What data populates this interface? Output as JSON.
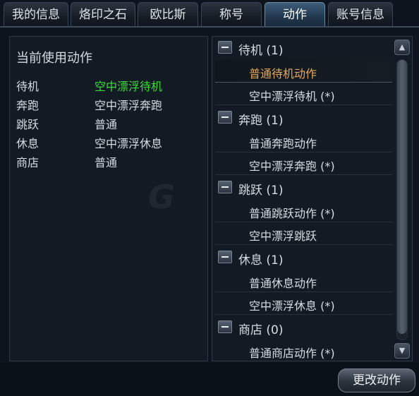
{
  "tabs": [
    {
      "label": "我的信息"
    },
    {
      "label": "烙印之石"
    },
    {
      "label": "欧比斯"
    },
    {
      "label": "称号"
    },
    {
      "label": "动作",
      "active": true
    },
    {
      "label": "账号信息"
    }
  ],
  "current": {
    "title": "当前使用动作",
    "rows": [
      {
        "key": "待机",
        "value": "空中漂浮待机",
        "highlight": true
      },
      {
        "key": "奔跑",
        "value": "空中漂浮奔跑"
      },
      {
        "key": "跳跃",
        "value": "普通"
      },
      {
        "key": "休息",
        "value": "空中漂浮休息"
      },
      {
        "key": "商店",
        "value": "普通"
      }
    ]
  },
  "action_list": [
    {
      "category": "待机 (1)",
      "items": [
        {
          "label": "普通待机动作",
          "selected": true
        },
        {
          "label": "空中漂浮待机 (*)"
        }
      ]
    },
    {
      "category": "奔跑 (1)",
      "items": [
        {
          "label": "普通奔跑动作"
        },
        {
          "label": "空中漂浮奔跑 (*)"
        }
      ]
    },
    {
      "category": "跳跃 (1)",
      "items": [
        {
          "label": "普通跳跃动作 (*)"
        },
        {
          "label": "空中漂浮跳跃"
        }
      ]
    },
    {
      "category": "休息 (1)",
      "items": [
        {
          "label": "普通休息动作"
        },
        {
          "label": "空中漂浮休息 (*)"
        }
      ]
    },
    {
      "category": "商店 (0)",
      "items": [
        {
          "label": "普通商店动作 (*)"
        }
      ]
    }
  ],
  "buttons": {
    "change": "更改动作"
  },
  "icons": {
    "collapse": "minus-icon",
    "scroll_up": "arrow-up-icon",
    "scroll_down": "arrow-down-icon"
  },
  "colors": {
    "highlight": "#3bdc3b",
    "selected": "#e6a85a",
    "active_tab": "#3d5d7a"
  }
}
